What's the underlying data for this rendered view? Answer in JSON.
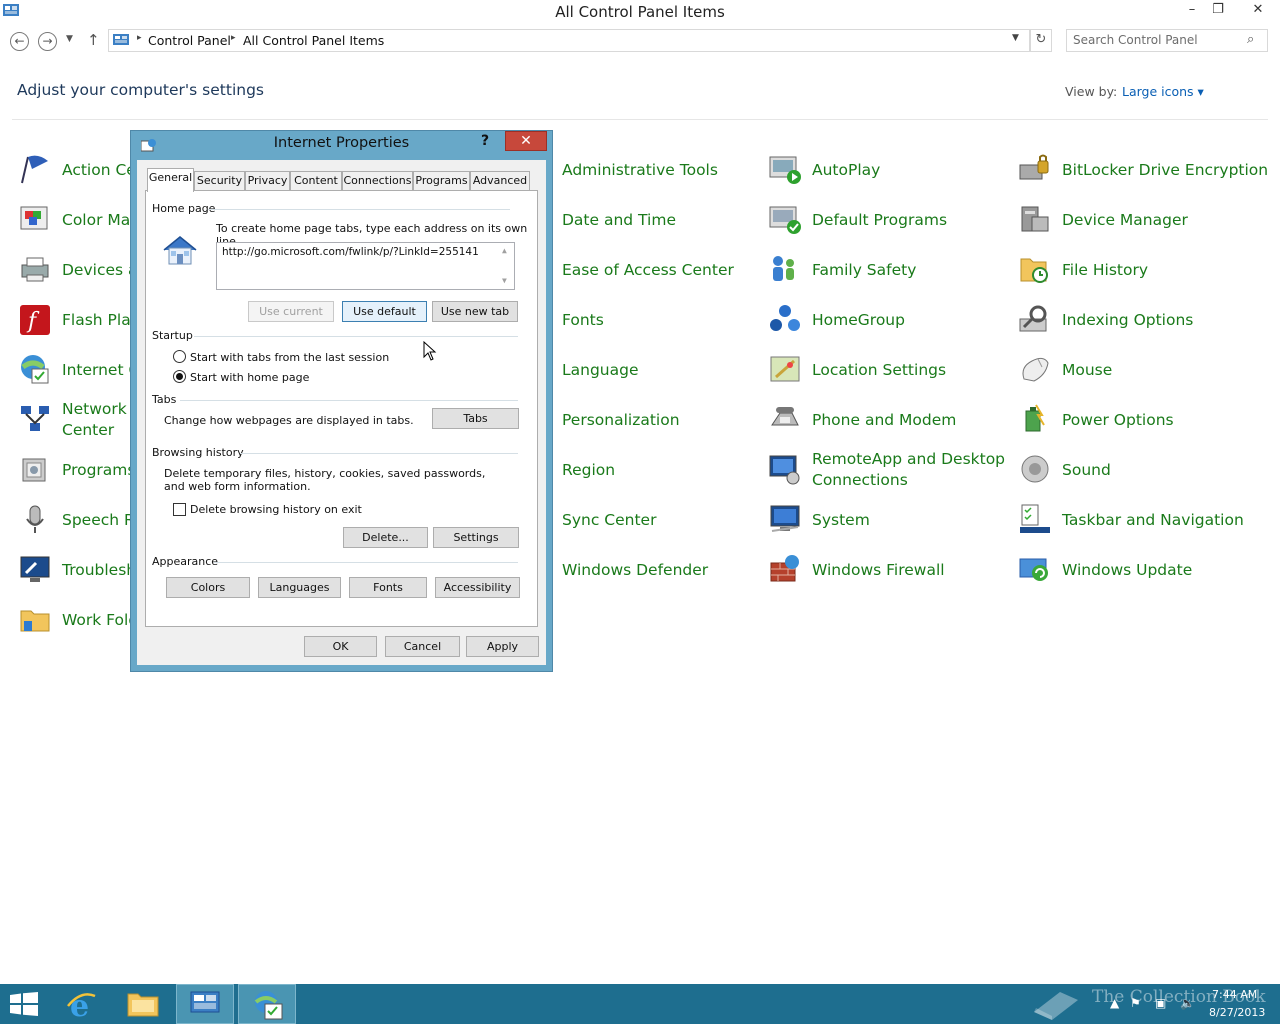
{
  "window": {
    "title": "All Control Panel Items",
    "minimize": "–",
    "maximize": "❐",
    "close": "✕"
  },
  "address": {
    "crumbs": [
      "Control Panel",
      "All Control Panel Items"
    ],
    "search_placeholder": "Search Control Panel"
  },
  "header": {
    "heading": "Adjust your computer's settings",
    "view_by_label": "View by:",
    "view_by_value": "Large icons ▾"
  },
  "items": {
    "c1": [
      "Action Center",
      "Color Management",
      "Devices and Printers",
      "Flash Player",
      "Internet Options",
      "Network and Sharing Center",
      "Programs and Features",
      "Speech Recognition",
      "Troubleshooting",
      "Work Folders"
    ],
    "c2": [
      "Administrative Tools",
      "Date and Time",
      "Ease of Access Center",
      "Fonts",
      "Language",
      "Personalization",
      "Region",
      "Sync Center",
      "Windows Defender"
    ],
    "c3": [
      "AutoPlay",
      "Default Programs",
      "Family Safety",
      "HomeGroup",
      "Location Settings",
      "Phone and Modem",
      "RemoteApp and Desktop Connections",
      "System",
      "Windows Firewall"
    ],
    "c4": [
      "BitLocker Drive Encryption",
      "Device Manager",
      "File History",
      "Indexing Options",
      "Mouse",
      "Power Options",
      "Sound",
      "Taskbar and Navigation",
      "Windows Update"
    ]
  },
  "item_text": {
    "c1_0": "Action Cen",
    "c1_1": "Color Man",
    "c1_2": "Devices ar",
    "c1_3": "Flash Play",
    "c1_4": "Internet O",
    "c1_5a": "Network a",
    "c1_5b": "Center",
    "c1_6": "Programs",
    "c1_7": "Speech Re",
    "c1_8": "Troublesh",
    "c1_9": "Work Fold",
    "c3_6a": "RemoteApp and Desktop",
    "c3_6b": "Connections"
  },
  "dialog": {
    "title": "Internet Properties",
    "help": "?",
    "close": "✕",
    "tabs": [
      "General",
      "Security",
      "Privacy",
      "Content",
      "Connections",
      "Programs",
      "Advanced"
    ],
    "home_page": {
      "label": "Home page",
      "hint": "To create home page tabs, type each address on its own line.",
      "url": "http://go.microsoft.com/fwlink/p/?LinkId=255141",
      "use_current": "Use current",
      "use_default": "Use default",
      "use_new_tab": "Use new tab"
    },
    "startup": {
      "label": "Startup",
      "opt1": "Start with tabs from the last session",
      "opt2": "Start with home page",
      "selected": 2
    },
    "tabs_group": {
      "label": "Tabs",
      "desc": "Change how webpages are displayed in tabs.",
      "button": "Tabs"
    },
    "history": {
      "label": "Browsing history",
      "desc": "Delete temporary files, history, cookies, saved passwords, and web form information.",
      "checkbox": "Delete browsing history on exit",
      "checked": false,
      "delete": "Delete...",
      "settings": "Settings"
    },
    "appearance": {
      "label": "Appearance",
      "colors": "Colors",
      "languages": "Languages",
      "fonts": "Fonts",
      "accessibility": "Accessibility"
    },
    "ok": "OK",
    "cancel": "Cancel",
    "apply": "Apply"
  },
  "taskbar": {
    "time": "7:44 AM",
    "date": "8/27/2013",
    "watermark": "The Collection Book"
  },
  "colors": {
    "link_green": "#1a7a1a",
    "heading_blue": "#1e395b",
    "taskbar": "#1e6e8f",
    "dialog_frame": "#68a8c8",
    "close_red": "#c7483b"
  }
}
